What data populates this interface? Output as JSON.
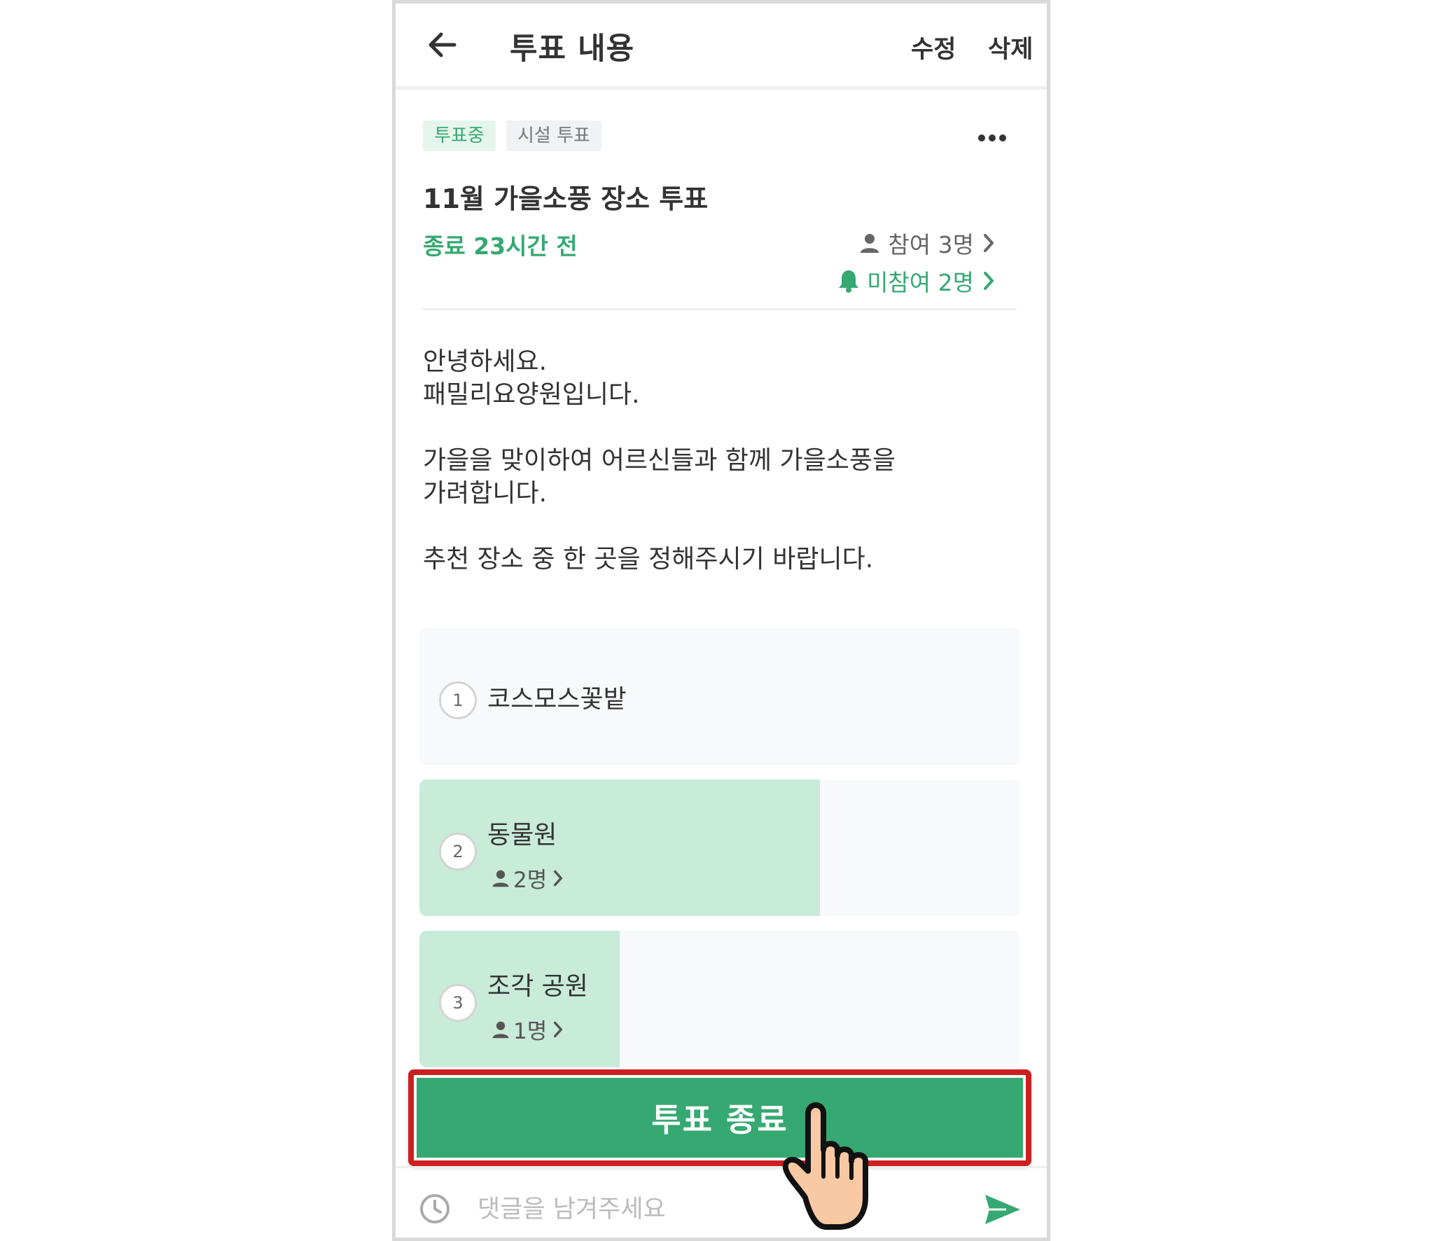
{
  "header": {
    "title": "투표 내용",
    "edit_label": "수정",
    "delete_label": "삭제"
  },
  "post": {
    "tags": [
      "투표중",
      "시설 투표"
    ],
    "title": "11월 가을소풍 장소 투표",
    "deadline": "종료 23시간 전",
    "participants": "참여 3명",
    "non_participants": "미참여 2명",
    "body_lines": [
      "안녕하세요.",
      "패밀리요양원입니다.",
      "",
      "가을을 맞이하여 어르신들과 함께 가을소풍을",
      "가려합니다.",
      "",
      "추천 장소 중 한 곳을 정해주시기 바랍니다."
    ]
  },
  "options": [
    {
      "number": "1",
      "label": "코스모스꽃밭",
      "count": "",
      "fraction": 0
    },
    {
      "number": "2",
      "label": "동물원",
      "count": "2명",
      "fraction": 0.667
    },
    {
      "number": "3",
      "label": "조각 공원",
      "count": "1명",
      "fraction": 0.333
    }
  ],
  "end_button_label": "투표 종료",
  "comment": {
    "placeholder": "댓글을 남겨주세요"
  },
  "colors": {
    "accent": "#36a872",
    "option_fill": "#c8ebda",
    "highlight_border": "#cc1f1f"
  }
}
